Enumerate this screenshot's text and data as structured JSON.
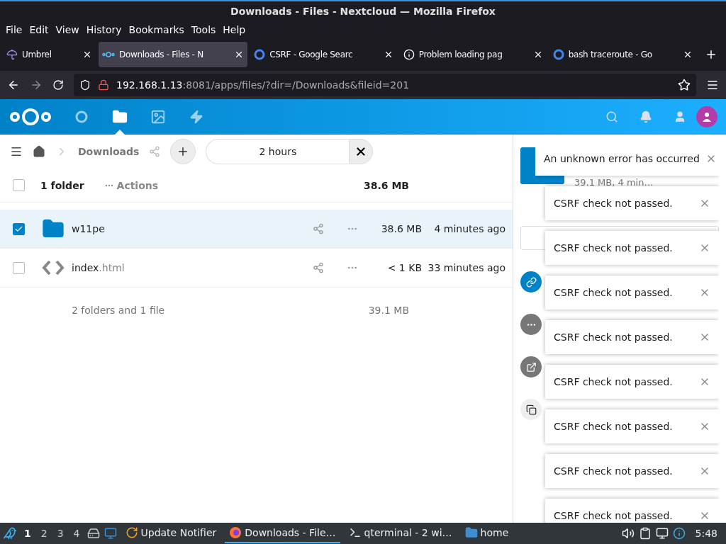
{
  "window": {
    "title": "Downloads - Files - Nextcloud — Mozilla Firefox"
  },
  "menu": [
    "File",
    "Edit",
    "View",
    "History",
    "Bookmarks",
    "Tools",
    "Help"
  ],
  "tabs": [
    {
      "label": "Umbrel",
      "kind": "umbrel",
      "selected": false
    },
    {
      "label": "Downloads - Files - N",
      "kind": "nextcloud",
      "selected": true
    },
    {
      "label": "CSRF - Google Searc",
      "kind": "google",
      "selected": false
    },
    {
      "label": "Problem loading pag",
      "kind": "info",
      "selected": false
    },
    {
      "label": "bash traceroute - Go",
      "kind": "google",
      "selected": false
    }
  ],
  "url": {
    "host": "192.168.1.13",
    "rest": ":8081/apps/files/?dir=/Downloads&fileid=201"
  },
  "nc_nav": [
    {
      "kind": "dashboard",
      "selected": false
    },
    {
      "kind": "files",
      "selected": true
    },
    {
      "kind": "photos",
      "selected": false
    },
    {
      "kind": "activity",
      "selected": false
    }
  ],
  "breadcrumb": "Downloads",
  "filter": "2 hours",
  "header": {
    "checked": false,
    "count": "1 folder",
    "actions": "Actions",
    "size": "38.6 MB"
  },
  "rows": [
    {
      "kind": "folder",
      "name": "w11pe",
      "selected": true,
      "size": "38.6 MB",
      "modified": "4 minutes ago"
    },
    {
      "kind": "code",
      "name": "index",
      "ext": ".html",
      "selected": false,
      "size": "< 1 KB",
      "modified": "33 minutes ago"
    }
  ],
  "summary": {
    "text": "2 folders and 1 file",
    "size": "39.1 MB"
  },
  "sidebar": {
    "meta": "39.1 MB, 4 min…"
  },
  "toasts": [
    "An unknown error has occurred",
    "CSRF check not passed.",
    "CSRF check not passed.",
    "CSRF check not passed.",
    "CSRF check not passed.",
    "CSRF check not passed.",
    "CSRF check not passed.",
    "CSRF check not passed.",
    "CSRF check not passed."
  ],
  "taskbar": {
    "workspaces": [
      {
        "label": "1",
        "selected": true
      },
      {
        "label": "2",
        "selected": false
      },
      {
        "label": "3",
        "selected": false
      },
      {
        "label": "4",
        "selected": false
      }
    ],
    "apps": [
      {
        "kind": "update",
        "label": "Update Notifier",
        "selected": false
      },
      {
        "kind": "firefox",
        "label": "Downloads - File…",
        "selected": true
      },
      {
        "kind": "terminal",
        "label": "qterminal - 2 wi…",
        "selected": false
      },
      {
        "kind": "folder",
        "label": "home",
        "selected": false
      }
    ],
    "clock": "5:48"
  }
}
